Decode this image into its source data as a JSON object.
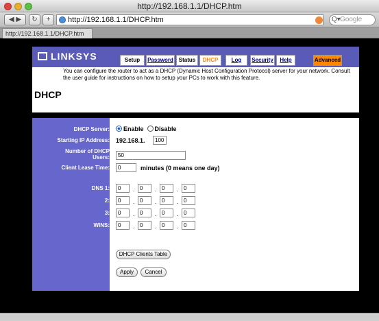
{
  "window": {
    "title": "http://192.168.1.1/DHCP.htm"
  },
  "toolbar": {
    "back": "◀",
    "forward": "▶",
    "reload": "↻",
    "add": "+",
    "url": "http://192.168.1.1/DHCP.htm",
    "search_placeholder": "Google",
    "search_icon": "Q▾"
  },
  "tab": {
    "label": "http://192.168.1.1/DHCP.htm"
  },
  "header": {
    "logo": "LINKSYS",
    "nav": [
      "Setup",
      "Password",
      "Status",
      "DHCP",
      "Log",
      "Security",
      "Help",
      "Advanced"
    ],
    "active_tab": "DHCP",
    "title": "DHCP",
    "description": "You can configure the router to act as a DHCP (Dynamic Host Configuration Protocol) server for your network. Consult the user guide for instructions on how to setup your PCs to work with this feature."
  },
  "form": {
    "dhcp_server_label": "DHCP Server:",
    "enable_label": "Enable",
    "disable_label": "Disable",
    "starting_ip_label": "Starting IP Address:",
    "ip_prefix": "192.168.1.",
    "ip_last": "100",
    "num_users_label": "Number of DHCP Users:",
    "num_users": "50",
    "lease_label": "Client Lease Time:",
    "lease_value": "0",
    "lease_suffix": "minutes (0 means one day)",
    "dns1_label": "DNS 1:",
    "dns2_label": "2:",
    "dns3_label": "3:",
    "wins_label": "WINS:",
    "dns1": [
      "0",
      "0",
      "0",
      "0"
    ],
    "dns2": [
      "0",
      "0",
      "0",
      "0"
    ],
    "dns3": [
      "0",
      "0",
      "0",
      "0"
    ],
    "wins": [
      "0",
      "0",
      "0",
      "0"
    ],
    "clients_table_button": "DHCP Clients Table",
    "apply_button": "Apply",
    "cancel_button": "Cancel"
  },
  "colors": {
    "nav_bg": "#5a5ab8",
    "sidebar_bg": "#6666cc",
    "accent": "#ff8800"
  }
}
